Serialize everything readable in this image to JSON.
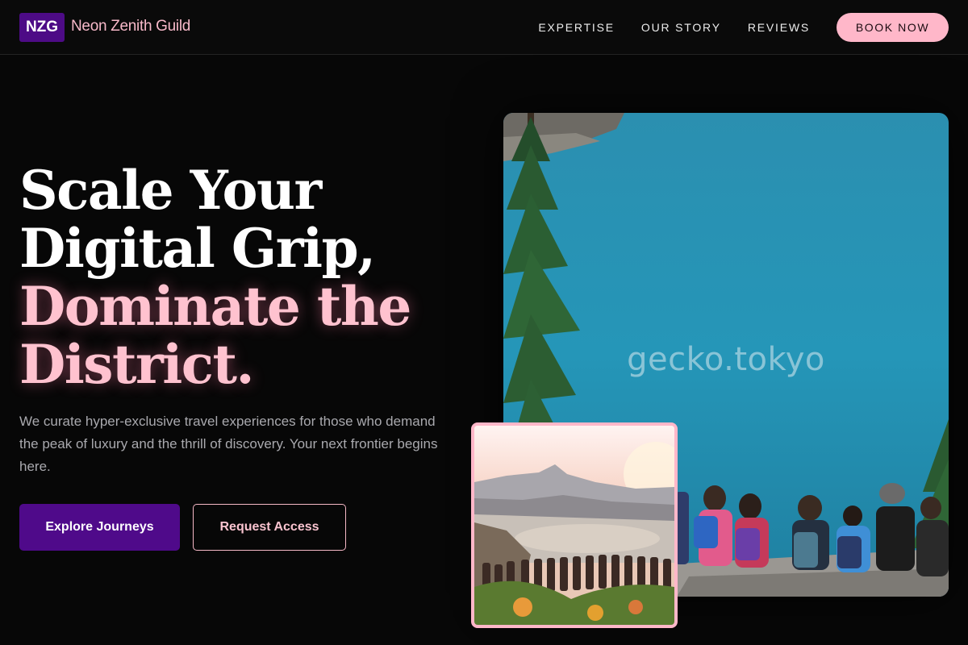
{
  "header": {
    "logo_text": "NZG",
    "brand_name": "Neon Zenith Guild",
    "nav": [
      {
        "label": "EXPERTISE"
      },
      {
        "label": "OUR STORY"
      },
      {
        "label": "REVIEWS"
      }
    ],
    "cta_label": "BOOK NOW"
  },
  "hero": {
    "title_line1": "Scale Your",
    "title_line2": "Digital Grip,",
    "title_line3": "Dominate the",
    "title_line4": "District.",
    "description": "We curate hyper-exclusive travel experiences for those who demand the peak of luxury and the thrill of discovery. Your next frontier begins here.",
    "primary_button": "Explore Journeys",
    "secondary_button": "Request Access"
  },
  "images": {
    "main_watermark": "gecko.tokyo",
    "main_photo_subject": "hikers-overlooking-turquoise-lake",
    "inset_photo_subject": "crowd-watching-sunset-over-bay"
  },
  "colors": {
    "accent_purple": "#4f0a8a",
    "accent_pink": "#ffb7c9",
    "background": "#070707"
  }
}
